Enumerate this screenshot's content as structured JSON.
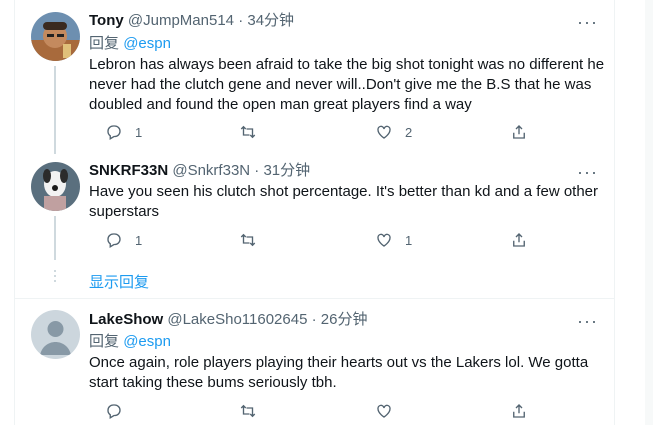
{
  "tweets": [
    {
      "name": "Tony",
      "handle": "@JumpMan514",
      "time": "34分钟",
      "reply_prefix": "回复",
      "reply_to": "@espn",
      "text": "Lebron has always been afraid to take the big shot tonight was no different he never had the clutch gene and never will..Don't give me the B.S that he was doubled and found the open man great players find a way",
      "replies": "1",
      "retweets": "",
      "likes": "2"
    },
    {
      "name": "SNKRF33N",
      "handle": "@Snkrf33N",
      "time": "31分钟",
      "text": "Have you seen his clutch shot percentage. It's better than kd and a few other superstars",
      "replies": "1",
      "retweets": "",
      "likes": "1"
    },
    {
      "name": "LakeShow",
      "handle": "@LakeSho11602645",
      "time": "26分钟",
      "reply_prefix": "回复",
      "reply_to": "@espn",
      "text": "Once again, role players playing their hearts out vs the Lakers lol. We gotta start taking these bums seriously tbh.",
      "replies": "",
      "retweets": "",
      "likes": ""
    }
  ],
  "show_more_replies": "显示回复",
  "separator": "·",
  "icons": {
    "more": "more-icon",
    "reply": "reply-icon",
    "retweet": "retweet-icon",
    "like": "heart-icon",
    "share": "share-icon"
  },
  "colors": {
    "accent": "#1d9bf0",
    "muted": "#536471",
    "thread_line": "#cfd9de"
  }
}
